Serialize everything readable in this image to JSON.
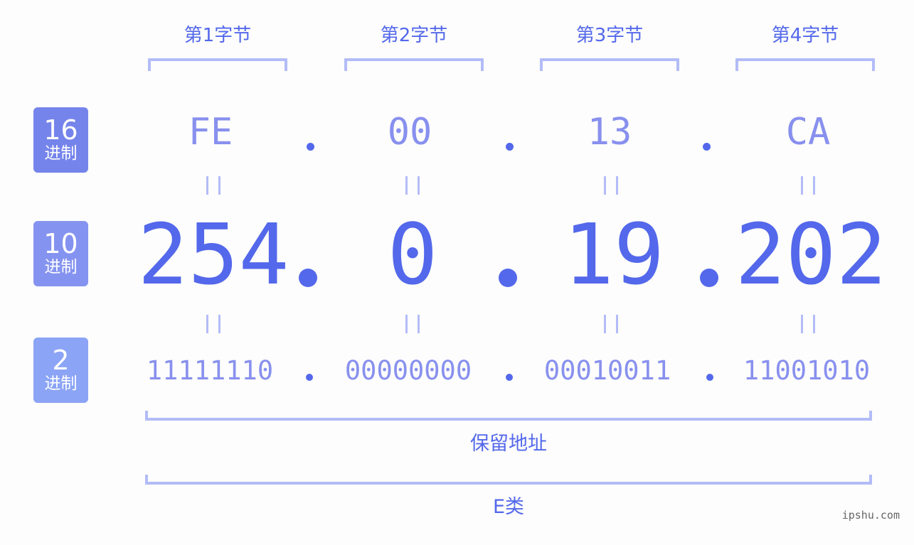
{
  "byte_headers": [
    "第1字节",
    "第2字节",
    "第3字节",
    "第4字节"
  ],
  "rows": {
    "hex": {
      "badge_number": "16",
      "badge_label": "进制",
      "badge_color": "#7584eb",
      "values": [
        "FE",
        "00",
        "13",
        "CA"
      ]
    },
    "decimal": {
      "badge_number": "10",
      "badge_label": "进制",
      "badge_color": "#8593f0",
      "values": [
        "254",
        "0",
        "19",
        "202"
      ]
    },
    "binary": {
      "badge_number": "2",
      "badge_label": "进制",
      "badge_color": "#8ba4f5",
      "values": [
        "11111110",
        "00000000",
        "00010011",
        "11001010"
      ]
    }
  },
  "ip_address": "254.0.19.202",
  "address_type": "保留地址",
  "address_class": "E类",
  "watermark": "ipshu.com",
  "colors": {
    "accent": "#5468eb",
    "secondary_text": "#8890ee",
    "bracket": "#b3bcf8",
    "background": "#fcfdfc"
  }
}
